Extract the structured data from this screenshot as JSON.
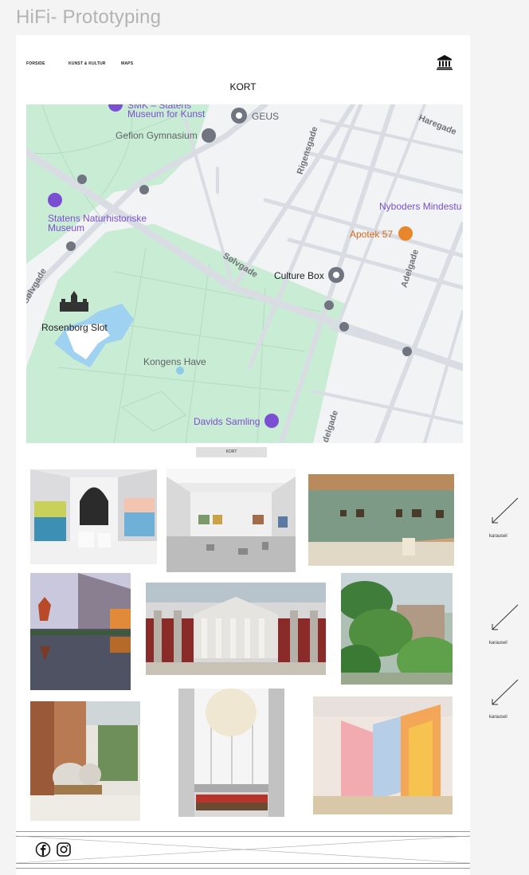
{
  "canvas": {
    "title": "HiFi- Prototyping"
  },
  "nav": {
    "items": [
      {
        "label": "FORSIDE"
      },
      {
        "label": "KUNST & KULTUR"
      },
      {
        "label": "MAPS"
      }
    ],
    "logo_icon": "museum-icon"
  },
  "section": {
    "title": "KORT"
  },
  "map": {
    "labels": {
      "smk": "SMK - Statens\nMuseum for Kunst",
      "smk_line1": "SMK – Statens",
      "smk_line2": "Museum for Kunst",
      "geus": "GEUS",
      "gefion": "Gefion Gymnasium",
      "naturhist_line1": "Statens Naturhistoriske",
      "naturhist_line2": "Museum",
      "nyboders": "Nyboders Mindestu",
      "apotek": "Apotek 57",
      "culture_box": "Culture Box",
      "rosenborg": "Rosenborg Slot",
      "kongens_have": "Kongens Have",
      "davids": "Davids Samling",
      "street_solvgade": "Sølvgade",
      "street_rigensgade": "Rigensgade",
      "street_haregade": "Haregade",
      "street_adelgade": "Adelgade",
      "street_adelgade2": "Adelgade",
      "street_solvgade_left": "Sølvgade"
    },
    "colors": {
      "park": "#c9ecd4",
      "water": "#9fd1f0",
      "road": "#d9dde3",
      "poi_purple": "#7b4fd1",
      "poi_gray": "#707580",
      "poi_orange": "#e8862c"
    }
  },
  "kort_button": {
    "label": "KORT"
  },
  "gallery": {
    "images": [
      {
        "name": "white-gallery-with-paintings"
      },
      {
        "name": "bright-sculpture-hall"
      },
      {
        "name": "green-wall-painting-gallery"
      },
      {
        "name": "museum-building-reflection-at-dusk"
      },
      {
        "name": "classical-columned-sculpture-hall"
      },
      {
        "name": "palm-house-winter-garden"
      },
      {
        "name": "brick-atrium-with-sculptures"
      },
      {
        "name": "window-with-paper-lantern"
      },
      {
        "name": "colorful-translucent-curtains"
      }
    ]
  },
  "side_notes": [
    {
      "label": "karausel"
    },
    {
      "label": "karausel"
    },
    {
      "label": "karausel"
    }
  ],
  "footer": {
    "icons": [
      "facebook-icon",
      "instagram-icon"
    ]
  }
}
